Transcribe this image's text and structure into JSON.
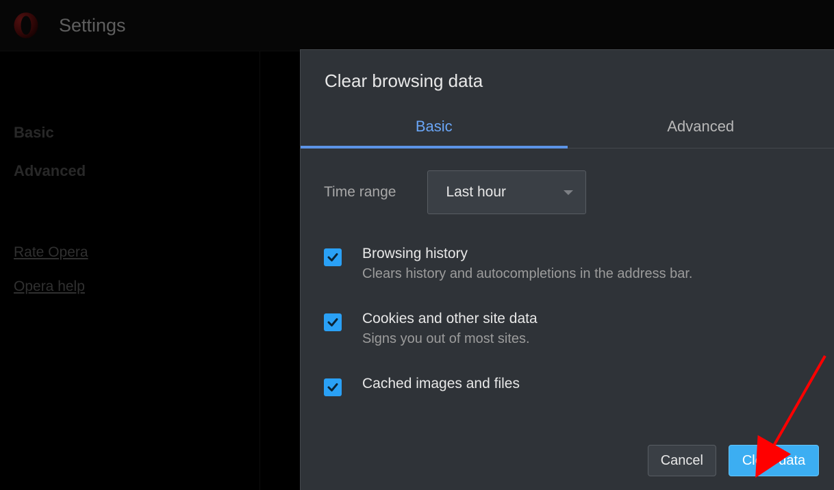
{
  "header": {
    "title": "Settings"
  },
  "sidebar": {
    "items": [
      {
        "label": "Basic"
      },
      {
        "label": "Advanced"
      }
    ],
    "links": [
      {
        "label": "Rate Opera"
      },
      {
        "label": "Opera help"
      }
    ]
  },
  "dialog": {
    "title": "Clear browsing data",
    "tabs": {
      "basic": "Basic",
      "advanced": "Advanced"
    },
    "time_range": {
      "label": "Time range",
      "value": "Last hour"
    },
    "options": [
      {
        "title": "Browsing history",
        "desc": "Clears history and autocompletions in the address bar."
      },
      {
        "title": "Cookies and other site data",
        "desc": "Signs you out of most sites."
      },
      {
        "title": "Cached images and files",
        "desc": ""
      }
    ],
    "buttons": {
      "cancel": "Cancel",
      "clear": "Clear data"
    }
  },
  "colors": {
    "accent": "#3caef2",
    "link_blue": "#5c93e6"
  }
}
